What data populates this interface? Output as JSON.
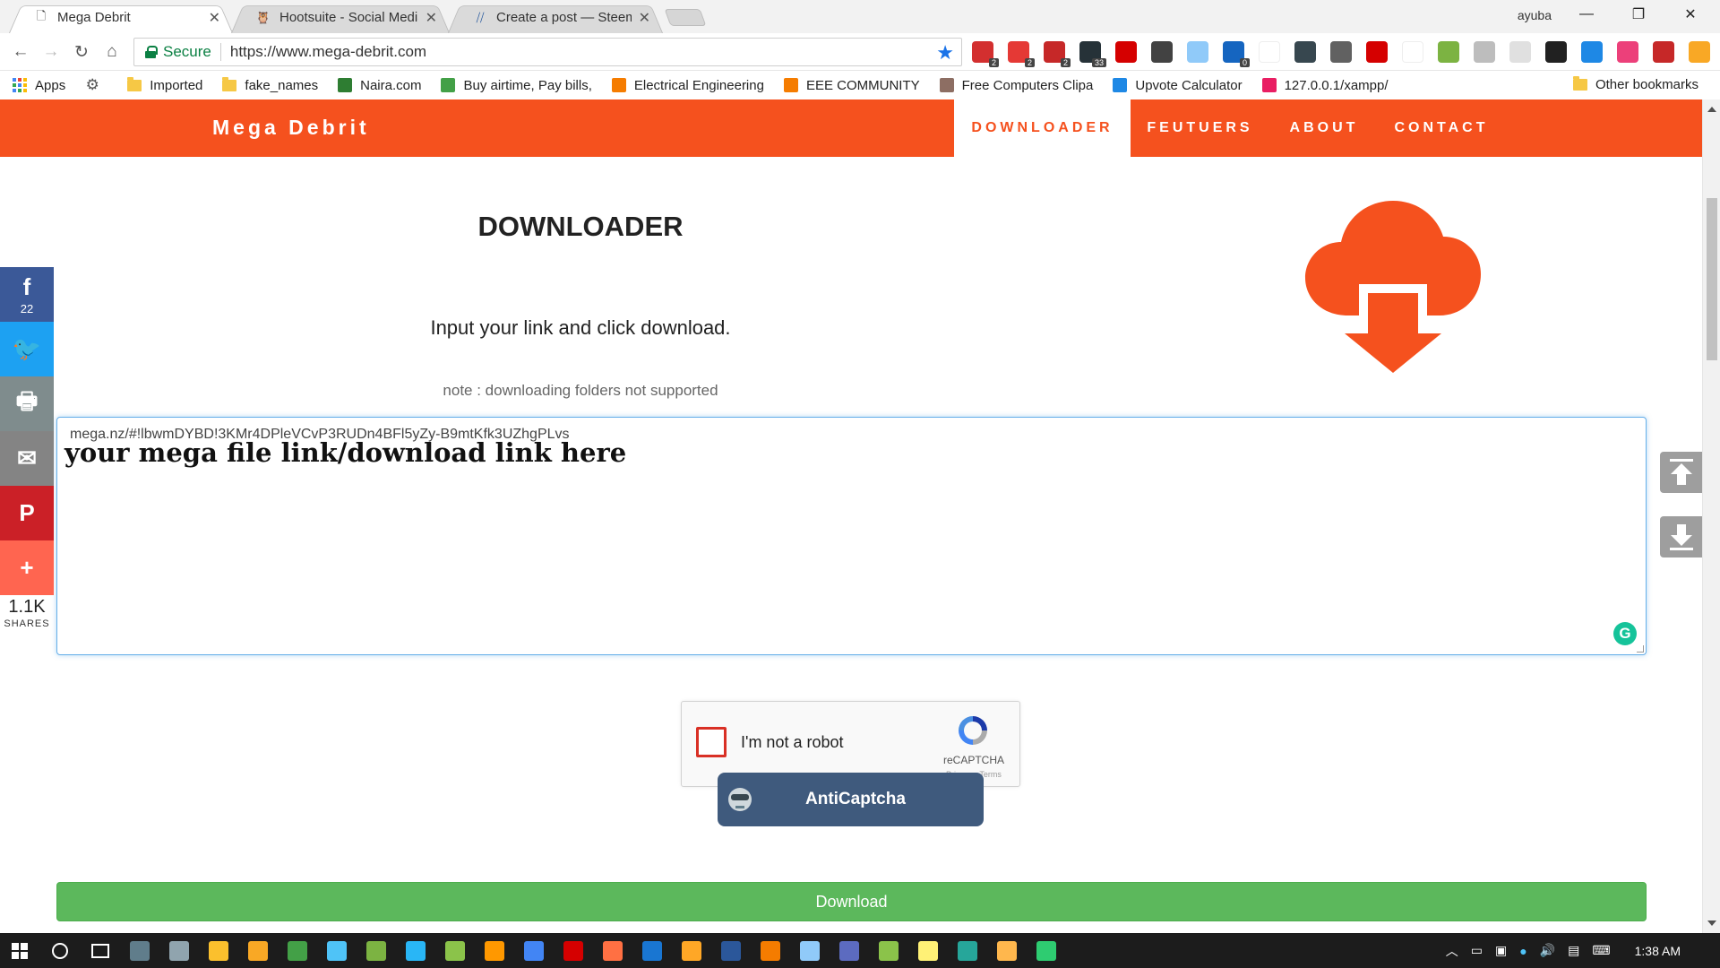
{
  "browser": {
    "tabs": [
      {
        "title": "Mega Debrit",
        "active": true
      },
      {
        "title": "Hootsuite - Social Media",
        "active": false
      },
      {
        "title": "Create a post — Steemit",
        "active": false
      }
    ],
    "user_name": "ayuba",
    "window_controls": {
      "minimize": "—",
      "restore": "❐",
      "close": "✕"
    },
    "secure_label": "Secure",
    "url": "https://www.mega-debrit.com",
    "extensions": [
      {
        "icon": "opera-ext-icon",
        "badge": "2",
        "color": "#d32f2f"
      },
      {
        "icon": "adblock-icon",
        "badge": "2",
        "color": "#e53935"
      },
      {
        "icon": "shield-ext-icon",
        "badge": "2",
        "color": "#c62828"
      },
      {
        "icon": "chat-ext-icon",
        "badge": "33",
        "color": "#263238"
      },
      {
        "icon": "lastpass-icon",
        "badge": "",
        "color": "#d50000"
      },
      {
        "icon": "square-ext-icon",
        "badge": "",
        "color": "#424242"
      },
      {
        "icon": "fst-ext-icon",
        "badge": "",
        "color": "#90caf9"
      },
      {
        "icon": "profile-ext-icon",
        "badge": "0",
        "color": "#1565c0"
      },
      {
        "icon": "text-ext-icon",
        "badge": "",
        "color": "#ffffff"
      },
      {
        "icon": "db-ext-icon",
        "badge": "",
        "color": "#37474f"
      },
      {
        "icon": "qr-ext-icon",
        "badge": "",
        "color": "#616161"
      },
      {
        "icon": "ring-ext-icon",
        "badge": "",
        "color": "#d50000"
      },
      {
        "icon": "cursor-ext-icon",
        "badge": "",
        "color": "#ffffff"
      },
      {
        "icon": "check-ext-icon",
        "badge": "",
        "color": "#7cb342"
      },
      {
        "icon": "grid-ext-icon",
        "badge": "",
        "color": "#bdbdbd"
      },
      {
        "icon": "puzzle-ext-icon",
        "badge": "",
        "color": "#e0e0e0"
      },
      {
        "icon": "owl-ext-icon",
        "badge": "",
        "color": "#212121"
      },
      {
        "icon": "phone-ext-icon",
        "badge": "",
        "color": "#1e88e5"
      },
      {
        "icon": "pink-ext-icon",
        "badge": "",
        "color": "#ec407a"
      },
      {
        "icon": "bug-ext-icon",
        "badge": "",
        "color": "#c62828"
      },
      {
        "icon": "alert-ext-icon",
        "badge": "",
        "color": "#f9a825"
      }
    ],
    "bookmarks": [
      {
        "label": "Apps",
        "icon": "apps-icon"
      },
      {
        "label": "",
        "icon": "settings-icon"
      },
      {
        "label": "Imported",
        "icon": "folder-icon"
      },
      {
        "label": "fake_names",
        "icon": "folder-icon"
      },
      {
        "label": "Naira.com",
        "icon": "naira-icon"
      },
      {
        "label": "Buy airtime, Pay bills,",
        "icon": "grid-green-icon"
      },
      {
        "label": "Electrical Engineering",
        "icon": "blogger-icon"
      },
      {
        "label": "EEE COMMUNITY",
        "icon": "blogger-icon"
      },
      {
        "label": "Free Computers Clipa",
        "icon": "clipart-icon"
      },
      {
        "label": "Upvote Calculator",
        "icon": "lines-icon"
      },
      {
        "label": "127.0.0.1/xampp/",
        "icon": "xampp-icon"
      }
    ],
    "other_bookmarks": "Other bookmarks"
  },
  "site": {
    "brand": "Mega Debrit",
    "nav": [
      {
        "label": "DOWNLOADER",
        "active": true
      },
      {
        "label": "FEUTUERS",
        "active": false
      },
      {
        "label": "ABOUT",
        "active": false
      },
      {
        "label": "CONTACT",
        "active": false
      }
    ],
    "heading": "DOWNLOADER",
    "subtitle": "Input your link and click download.",
    "note": "note : downloading folders not supported",
    "link_value": "mega.nz/#!lbwmDYBD!3KMr4DPleVCvP3RUDn4BFl5yZy-B9mtKfk3UZhgPLvs",
    "link_placeholder": "your mega file link/download link here",
    "recaptcha": {
      "label": "I'm not a robot",
      "brand": "reCAPTCHA",
      "terms": "Privacy - Terms"
    },
    "anticaptcha": "AntiCaptcha",
    "download_label": "Download",
    "accent_color": "#f5511e",
    "share": {
      "facebook_count": "22",
      "total": "1.1K",
      "total_label": "SHARES",
      "buttons": [
        {
          "icon": "facebook-icon",
          "glyph": "f",
          "color": "#3b5998"
        },
        {
          "icon": "twitter-icon",
          "glyph": "🐦",
          "color": "#1da1f2"
        },
        {
          "icon": "print-icon",
          "glyph": "🖶",
          "color": "#7f8c8d"
        },
        {
          "icon": "email-icon",
          "glyph": "✉",
          "color": "#848484"
        },
        {
          "icon": "pinterest-icon",
          "glyph": "P",
          "color": "#cb2027"
        },
        {
          "icon": "more-icon",
          "glyph": "+",
          "color": "#ff6550"
        }
      ]
    }
  },
  "taskbar": {
    "clock": "1:38 AM",
    "apps": [
      "#607d8b",
      "#90a4ae",
      "#fbc02d",
      "#f9a825",
      "#43a047",
      "#4fc3f7",
      "#7cb342",
      "#29b6f6",
      "#8bc34a",
      "#ff9800",
      "#4285f4",
      "#d50000",
      "#ff7043",
      "#1976d2",
      "#ffa726",
      "#2b579a",
      "#f57c00",
      "#90caf9",
      "#5c6bc0",
      "#8bc34a",
      "#fff176",
      "#26a69a",
      "#ffb74d",
      "#2ecc71"
    ]
  }
}
